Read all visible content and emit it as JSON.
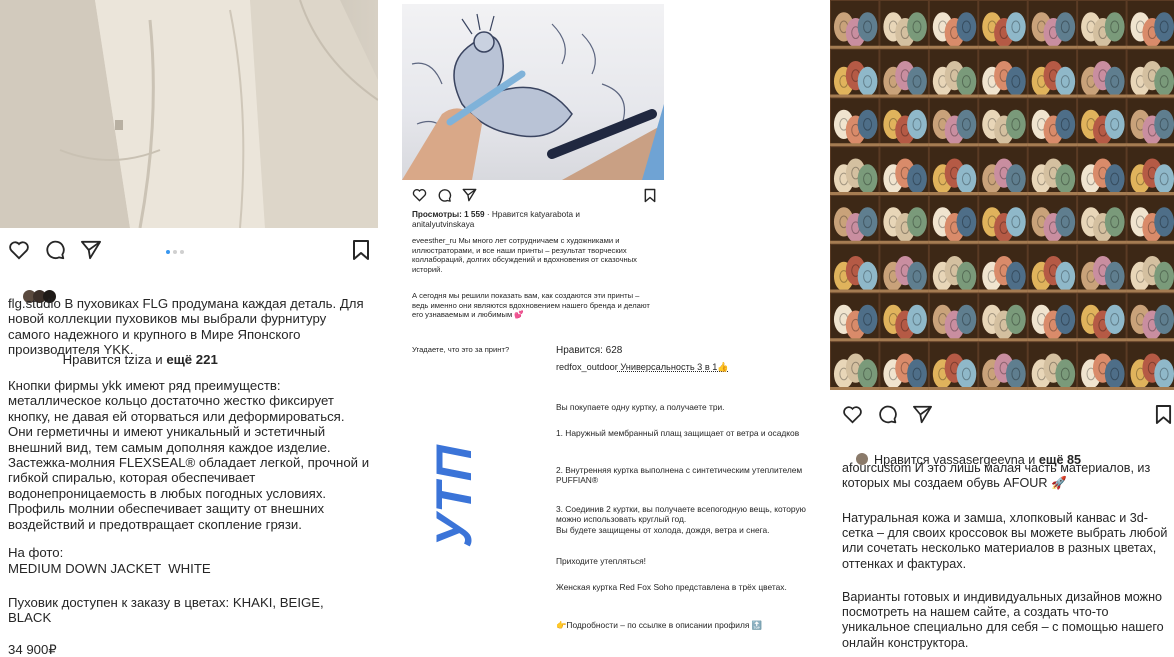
{
  "colors": {
    "accent": "#3b74d8",
    "text": "#262626",
    "dot_active": "#3897f0"
  },
  "post1": {
    "icons": [
      "heart-icon",
      "comment-icon",
      "share-icon",
      "bookmark-icon"
    ],
    "likes_prefix": "Нравится ",
    "likes_user": "tziza",
    "likes_mid": " и ",
    "likes_more": "ещё 221",
    "username": "flg.studio",
    "caption_first": " В пуховиках FLG продумана каждая деталь. Для новой коллекции пуховиков мы выбрали фурнитуру самого надежного и крупного в Мире Японского производителя YKK.",
    "para2": "Кнопки фирмы ykk имеют ряд преимуществ: металлическое кольцо достаточно жестко фиксирует кнопку, не давая ей оторваться или деформироваться. Они герметичны и имеют уникальный и эстетичный внешний вид, тем самым дополняя каждое изделие. Застежка-молния FLEXSEAL® обладает легкой, прочной и гибкой спиралью, которая обеспечивает водонепроницаемость в любых погодных условиях. Профиль молнии обеспечивает защиту от внешних воздействий и предотвращает скопление грязи.",
    "photo_label": "На фото:",
    "photo_value": "MEDIUM DOWN JACKET  WHITE",
    "colors_text": "Пуховик доступен к заказу в цветах: KHAKI, BEIGE, BLACK",
    "price": "34 900₽"
  },
  "post2": {
    "views_label": "Просмотры: 1 559",
    "views_rest": " · Нравится katyarabota и anitalyutvinskaya",
    "username": "eveesther_ru",
    "caption1": " Мы много лет сотрудничаем с художниками и иллюстраторами, и все наши принты – результат творческих коллабораций, долгих обсуждений и вдохновения от сказочных историй.",
    "caption2": "А сегодня мы решили показать вам, как создаются эти принты – ведь именно они являются вдохновением нашего бренда и делают его узнаваемым и любимым 💕",
    "question": "Угадаете, что это за принт?"
  },
  "utp": "УТП",
  "post3": {
    "likes_label": "Нравится: 628",
    "username": "redfox_outdoor",
    "headline": " Универсальность 3 в 1👍",
    "line1": "Вы покупаете одну куртку, а получаете три.",
    "line2": "1. Наружный мембранный плащ защищает от ветра и осадков",
    "line3": "2. Внутренняя куртка выполнена с синтетическим утеплителем PUFFIAN®",
    "line4": "3. Соединив 2 куртки, вы получаете всепогодную вещь, которую можно использовать круглый год.\nВы будете защищены от холода, дождя, ветра и снега.",
    "line5": "Приходите утепляться!",
    "line6": "Женская куртка Red Fox Soho представлена в трёх цветах.",
    "line7": "👉Подробности – по ссылке в описании профиля 🔝"
  },
  "post4": {
    "likes_prefix": "Нравится ",
    "likes_user": "vassasergeevna",
    "likes_mid": " и ",
    "likes_more": "ещё 85",
    "username": "afourcustom",
    "caption1": " И это лишь малая часть материалов, из которых мы создаем обувь AFOUR 🚀",
    "para2": "Натуральная кожа и замша, хлопковый канвас и 3d-сетка – для своих кроссовок вы можете выбрать любой или сочетать несколько материалов в разных цветах, оттенках и фактурах.",
    "para3": "Варианты готовых и индивидуальных дизайнов можно посмотреть на нашем сайте, а создать что-то уникальное специально для себя – с помощью нашего онлайн конструктора."
  }
}
